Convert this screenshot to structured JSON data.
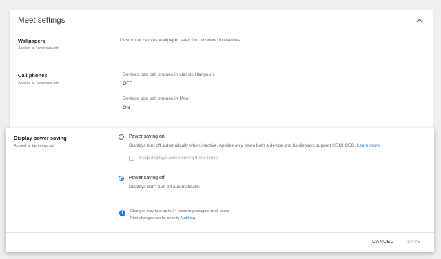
{
  "card": {
    "title": "Meet settings",
    "rows": {
      "wallpapers": {
        "title": "Wallpapers",
        "applied": "Applied at 'jambread.biz'",
        "description": "Custom or canvas wallpaper selection to show on devices"
      },
      "call_phones": {
        "title": "Call phones",
        "applied": "Applied at 'jambread.biz'",
        "hangouts_label": "Devices can call phones in classic Hangouts",
        "hangouts_value": "OFF",
        "meet_label": "Devices can call phones in Meet",
        "meet_value": "ON"
      }
    }
  },
  "panel": {
    "title": "Display power saving",
    "applied": "Applied at 'jambread.biz'",
    "option_on": {
      "label": "Power saving on",
      "description": "Displays turn off automatically when inactive. Applies only when both a device and its displays support HDMI CEC.",
      "learn_more": "Learn more",
      "checkbox_label": "Keep displays active during these times",
      "selected": false
    },
    "option_off": {
      "label": "Power saving off",
      "description": "Displays don't turn off automatically.",
      "selected": true
    },
    "info": {
      "line1": "Changes may take up to 24 hours to propagate to all users.",
      "line2_prefix": "Prior changes can be seen in",
      "audit_link": "Audit log"
    },
    "buttons": {
      "cancel": "CANCEL",
      "save": "SAVE"
    }
  },
  "colors": {
    "accent": "#1a73e8",
    "background": "#efefef"
  }
}
